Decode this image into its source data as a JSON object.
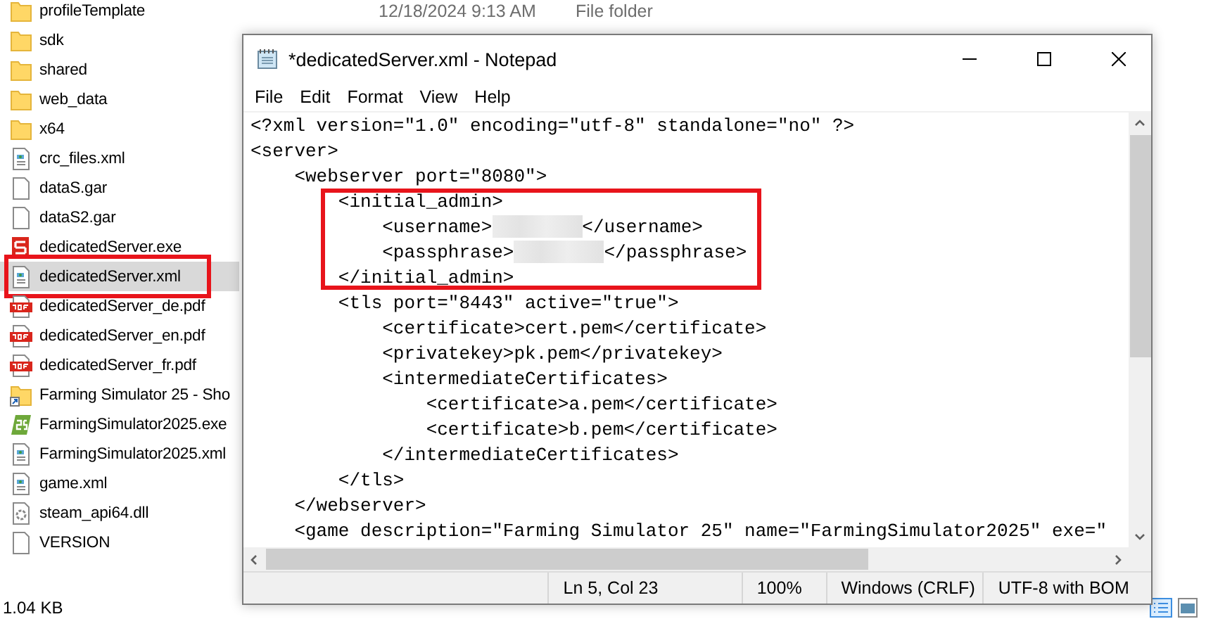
{
  "explorer": {
    "files": [
      {
        "name": "profileTemplate",
        "kind": "folder",
        "selected": false,
        "annotated": false,
        "date": "12/18/2024 9:13 AM",
        "type": "File folder"
      },
      {
        "name": "sdk",
        "kind": "folder",
        "selected": false,
        "annotated": false
      },
      {
        "name": "shared",
        "kind": "folder",
        "selected": false,
        "annotated": false
      },
      {
        "name": "web_data",
        "kind": "folder",
        "selected": false,
        "annotated": false
      },
      {
        "name": "x64",
        "kind": "folder",
        "selected": false,
        "annotated": false
      },
      {
        "name": "crc_files.xml",
        "kind": "xml",
        "selected": false,
        "annotated": false
      },
      {
        "name": "dataS.gar",
        "kind": "file",
        "selected": false,
        "annotated": false
      },
      {
        "name": "dataS2.gar",
        "kind": "file",
        "selected": false,
        "annotated": false
      },
      {
        "name": "dedicatedServer.exe",
        "kind": "exe",
        "selected": false,
        "annotated": false
      },
      {
        "name": "dedicatedServer.xml",
        "kind": "xml",
        "selected": true,
        "annotated": true
      },
      {
        "name": "dedicatedServer_de.pdf",
        "kind": "pdf",
        "selected": false,
        "annotated": false
      },
      {
        "name": "dedicatedServer_en.pdf",
        "kind": "pdf",
        "selected": false,
        "annotated": false
      },
      {
        "name": "dedicatedServer_fr.pdf",
        "kind": "pdf",
        "selected": false,
        "annotated": false
      },
      {
        "name": "Farming Simulator 25 - Sho",
        "kind": "shortcut",
        "selected": false,
        "annotated": false
      },
      {
        "name": "FarmingSimulator2025.exe",
        "kind": "app",
        "selected": false,
        "annotated": false
      },
      {
        "name": "FarmingSimulator2025.xml",
        "kind": "xml",
        "selected": false,
        "annotated": false
      },
      {
        "name": "game.xml",
        "kind": "xml",
        "selected": false,
        "annotated": false
      },
      {
        "name": "steam_api64.dll",
        "kind": "dll",
        "selected": false,
        "annotated": false
      },
      {
        "name": "VERSION",
        "kind": "file",
        "selected": false,
        "annotated": false
      }
    ],
    "status": "1.04 KB"
  },
  "notepad": {
    "title": "*dedicatedServer.xml - Notepad",
    "menu": [
      "File",
      "Edit",
      "Format",
      "View",
      "Help"
    ],
    "lines": [
      {
        "text": "<?xml version=\"1.0\" encoding=\"utf-8\" standalone=\"no\" ?>",
        "annotated": false
      },
      {
        "text": "<server>",
        "annotated": false
      },
      {
        "text": "    <webserver port=\"8080\">",
        "annotated": false
      },
      {
        "text": "        <initial_admin>",
        "annotated": true
      },
      {
        "text": "            <username>",
        "redacted": true,
        "after": "</username>",
        "annotated": true
      },
      {
        "text": "            <passphrase>",
        "redacted": true,
        "after": "</passphrase>",
        "annotated": true
      },
      {
        "text": "        </initial_admin>",
        "annotated": true
      },
      {
        "text": "        <tls port=\"8443\" active=\"true\">",
        "annotated": false
      },
      {
        "text": "            <certificate>cert.pem</certificate>",
        "annotated": false
      },
      {
        "text": "            <privatekey>pk.pem</privatekey>",
        "annotated": false
      },
      {
        "text": "            <intermediateCertificates>",
        "annotated": false
      },
      {
        "text": "                <certificate>a.pem</certificate>",
        "annotated": false
      },
      {
        "text": "                <certificate>b.pem</certificate>",
        "annotated": false
      },
      {
        "text": "            </intermediateCertificates>",
        "annotated": false
      },
      {
        "text": "        </tls>",
        "annotated": false
      },
      {
        "text": "    </webserver>",
        "annotated": false
      },
      {
        "text": "    <game description=\"Farming Simulator 25\" name=\"FarmingSimulator2025\" exe=\"",
        "annotated": false
      }
    ],
    "status": [
      "Ln 5, Col 23",
      "100%",
      "Windows (CRLF)",
      "UTF-8 with BOM"
    ]
  }
}
